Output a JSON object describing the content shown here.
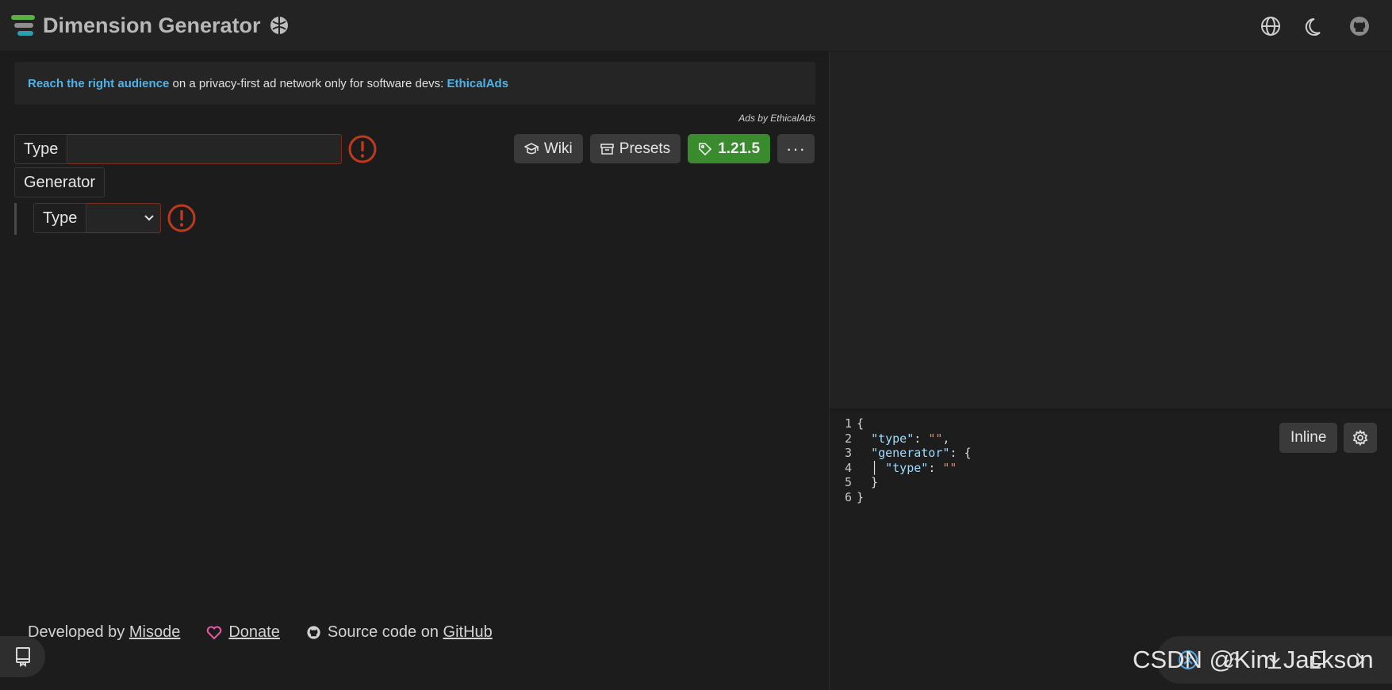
{
  "header": {
    "title": "Dimension Generator",
    "icons": [
      "logo-icon",
      "dimension-ball-icon",
      "language-icon",
      "theme-moon-icon",
      "github-icon"
    ]
  },
  "ad": {
    "lead_link": "Reach the right audience",
    "text": " on a privacy-first ad network only for software devs: ",
    "brand_link": "EthicalAds",
    "attribution": "Ads by EthicalAds"
  },
  "tree": {
    "type_label": "Type",
    "type_value": "",
    "generator_label": "Generator",
    "generator_type_label": "Type",
    "generator_type_value": ""
  },
  "toolbar": {
    "wiki_label": "Wiki",
    "presets_label": "Presets",
    "version_label": "1.21.5",
    "more_label": "···"
  },
  "footer": {
    "developed_prefix": "Developed by ",
    "developer_link": "Misode",
    "donate_label": "Donate",
    "source_prefix": "Source code on ",
    "source_link": "GitHub"
  },
  "editor": {
    "inline_label": "Inline",
    "lines": [
      "1",
      "2",
      "3",
      "4",
      "5",
      "6"
    ]
  },
  "colors": {
    "accent_green": "#3a8a2e",
    "error_red": "#c0391b",
    "link_blue": "#4fb3e8"
  },
  "watermark": "CSDN @Kim Jackson"
}
